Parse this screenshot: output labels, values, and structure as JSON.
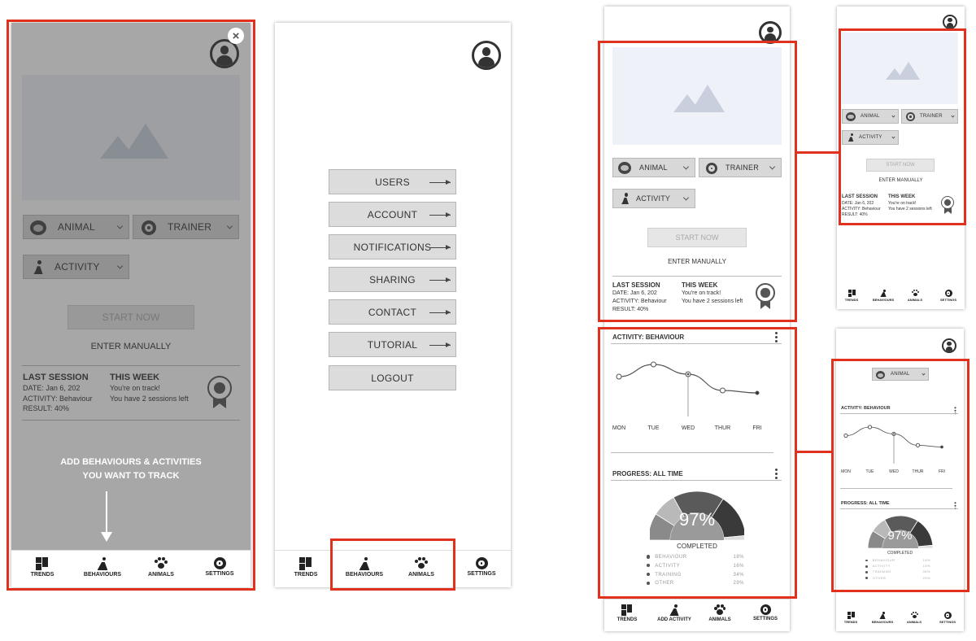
{
  "screen1": {
    "close_label": "×",
    "dropdowns": {
      "animal": "ANIMAL",
      "trainer": "TRAINER",
      "activity": "ACTIVITY"
    },
    "start_now": "START NOW",
    "enter_manually": "ENTER MANUALLY",
    "last_session": {
      "title": "LAST SESSION",
      "date": "DATE: Jan 6, 202",
      "activity": "ACTIVITY: Behaviour",
      "result": "RESULT: 40%"
    },
    "this_week": {
      "title": "THIS WEEK",
      "line1": "You're on track!",
      "line2": "You have 2 sessions left"
    },
    "coach_text_line1": "ADD BEHAVIOURS & ACTIVITIES",
    "coach_text_line2": "YOU WANT TO TRACK",
    "nav": [
      "TRENDS",
      "BEHAVIOURS",
      "ANIMALS",
      "SETTINGS"
    ]
  },
  "screen2": {
    "menu": [
      "USERS",
      "ACCOUNT",
      "NOTIFICATIONS",
      "SHARING",
      "CONTACT",
      "TUTORIAL",
      "LOGOUT"
    ],
    "nav": [
      "TRENDS",
      "BEHAVIOURS",
      "ANIMALS",
      "SETTINGS"
    ]
  },
  "screen3": {
    "dropdowns": {
      "animal": "ANIMAL",
      "trainer": "TRAINER",
      "activity": "ACTIVITY"
    },
    "start_now": "START NOW",
    "enter_manually": "ENTER MANUALLY",
    "last_session": {
      "title": "LAST SESSION",
      "date": "DATE: Jan 6, 202",
      "activity": "ACTIVITY: Behaviour",
      "result": "RESULT: 40%"
    },
    "this_week": {
      "title": "THIS WEEK",
      "line1": "You're on track!",
      "line2": "You have 2 sessions left"
    },
    "activity_title": "ACTIVITY: BEHAVIOUR",
    "days": [
      "MON",
      "TUE",
      "WED",
      "THUR",
      "FRI"
    ],
    "progress_title": "PROGRESS: ALL TIME",
    "percent": "97%",
    "completed": "COMPLETED",
    "legend": [
      {
        "label": "BEHAVIOUR",
        "value": "18%"
      },
      {
        "label": "ACTIVITY",
        "value": "16%"
      },
      {
        "label": "TRAINING",
        "value": "34%"
      },
      {
        "label": "OTHER",
        "value": "29%"
      }
    ],
    "nav": [
      "TRENDS",
      "ADD ACTIVITY",
      "ANIMALS",
      "SETTINGS"
    ]
  },
  "screen4": {
    "dropdowns": {
      "animal": "ANIMAL",
      "trainer": "TRAINER",
      "activity": "ACTIVITY"
    },
    "start_now": "START NOW",
    "enter_manually": "ENTER MANUALLY",
    "last_session": {
      "title": "LAST SESSION",
      "date": "DATE: Jan 6, 202",
      "activity": "ACTIVITY: Behaviour",
      "result": "RESULT: 40%"
    },
    "this_week": {
      "title": "THIS WEEK",
      "line1": "You're on track!",
      "line2": "You have 2 sessions left"
    },
    "nav": [
      "TRENDS",
      "BEHAVIOURS",
      "ANIMALS",
      "SETTINGS"
    ]
  },
  "screen5": {
    "dropdown_animal": "ANIMAL",
    "activity_title": "ACTIVITY: BEHAVIOUR",
    "days": [
      "MON",
      "TUE",
      "WED",
      "THUR",
      "FRI"
    ],
    "progress_title": "PROGRESS: ALL TIME",
    "percent": "97%",
    "completed": "COMPLETED",
    "legend": [
      {
        "label": "BEHAVIOUR",
        "value": "18%"
      },
      {
        "label": "ACTIVITY",
        "value": "16%"
      },
      {
        "label": "TRAINING",
        "value": "34%"
      },
      {
        "label": "OTHER",
        "value": "29%"
      }
    ],
    "nav": [
      "TRENDS",
      "BEHAVIOURS",
      "ANIMALS",
      "SETTINGS"
    ]
  },
  "colors": {
    "highlight": "#e0301e",
    "overlay": "#6e6e6e",
    "button": "#d8d8d8"
  },
  "chart_data": {
    "type": "line",
    "categories": [
      "MON",
      "TUE",
      "WED",
      "THUR",
      "FRI"
    ],
    "values": [
      55,
      70,
      58,
      38,
      35
    ],
    "xlabel": "",
    "ylabel": ""
  }
}
